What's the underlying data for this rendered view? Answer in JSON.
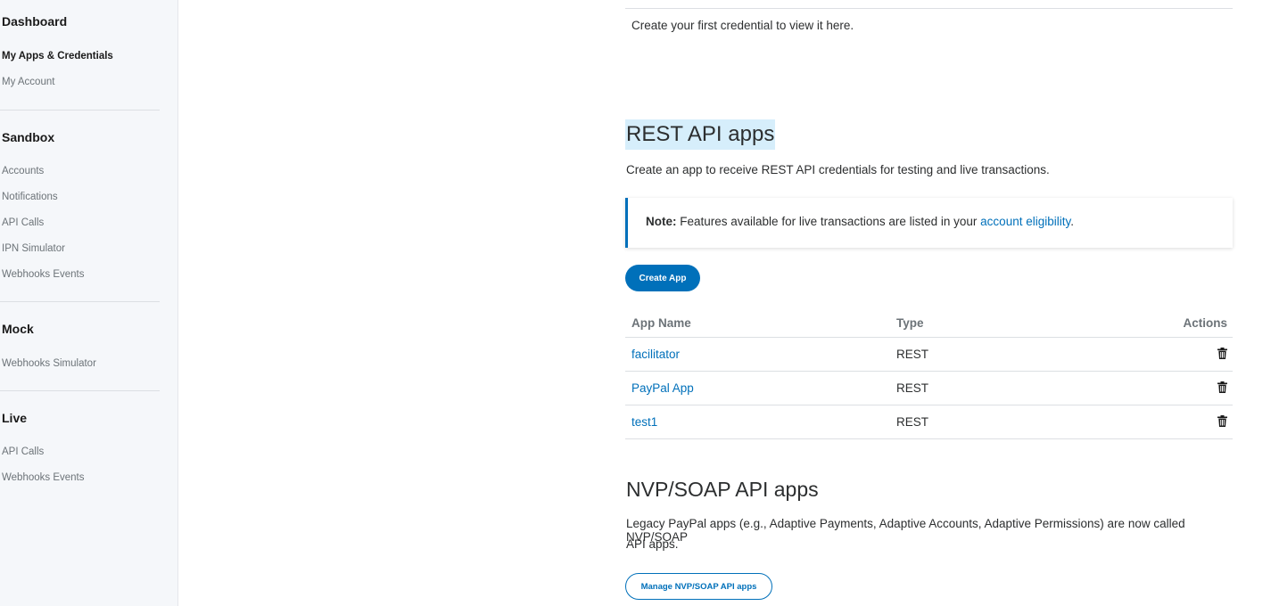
{
  "sidebar": {
    "dashboard": "Dashboard",
    "my_apps": "My Apps & Credentials",
    "my_account": "My Account",
    "sandbox": "Sandbox",
    "sandbox_items": [
      "Accounts",
      "Notifications",
      "API Calls",
      "IPN Simulator",
      "Webhooks Events"
    ],
    "mock": "Mock",
    "mock_items": [
      "Webhooks Simulator"
    ],
    "live": "Live",
    "live_items": [
      "API Calls",
      "Webhooks Events"
    ]
  },
  "credentials_empty": "Create your first credential to view it here.",
  "rest": {
    "title": "REST API apps",
    "desc": "Create an app to receive REST API credentials for testing and live transactions.",
    "note_label": "Note:",
    "note_text": " Features available for live transactions are listed in your ",
    "note_link": "account eligibility",
    "note_end": ".",
    "create_button": "Create App",
    "columns": [
      "App Name",
      "Type",
      "Actions"
    ],
    "rows": [
      {
        "name": "facilitator",
        "type": "REST"
      },
      {
        "name": "PayPal App",
        "type": "REST"
      },
      {
        "name": "test1",
        "type": "REST"
      }
    ]
  },
  "nvp": {
    "title": "NVP/SOAP API apps",
    "desc_line1": "Legacy PayPal apps (e.g., Adaptive Payments, Adaptive Accounts, Adaptive Permissions) are now called NVP/SOAP",
    "desc_line2": "API apps.",
    "manage_button": "Manage NVP/SOAP API apps"
  },
  "colors": {
    "accent": "#0070ba",
    "highlight": "#d6eefb",
    "sidebar_bg": "#f5f7fa"
  }
}
